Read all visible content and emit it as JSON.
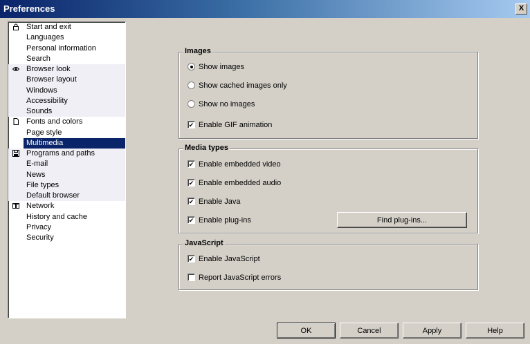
{
  "window": {
    "title": "Preferences",
    "close_glyph": "X"
  },
  "nav": {
    "groups": [
      {
        "icon": "lock-icon",
        "items": [
          "Start and exit",
          "Languages",
          "Personal information",
          "Search"
        ]
      },
      {
        "icon": "eye-icon",
        "items": [
          "Browser look",
          "Browser layout",
          "Windows",
          "Accessibility",
          "Sounds"
        ]
      },
      {
        "icon": "document-icon",
        "items": [
          "Fonts and colors",
          "Page style",
          "Multimedia"
        ]
      },
      {
        "icon": "floppy-icon",
        "items": [
          "Programs and paths",
          "E-mail",
          "News",
          "File types",
          "Default browser"
        ]
      },
      {
        "icon": "network-icon",
        "items": [
          "Network",
          "History and cache",
          "Privacy",
          "Security"
        ]
      }
    ],
    "selected": "Multimedia"
  },
  "images": {
    "title": "Images",
    "show_images": "Show images",
    "show_cached": "Show cached images only",
    "show_none": "Show no images",
    "selected_option": "show_images",
    "gif_animation": {
      "label": "Enable GIF animation",
      "checked": true
    }
  },
  "media": {
    "title": "Media types",
    "video": {
      "label": "Enable embedded video",
      "checked": true
    },
    "audio": {
      "label": "Enable embedded audio",
      "checked": true
    },
    "java": {
      "label": "Enable Java",
      "checked": true
    },
    "plugins": {
      "label": "Enable plug-ins",
      "checked": true
    },
    "find_plugins": "Find plug-ins..."
  },
  "javascript": {
    "title": "JavaScript",
    "enable": {
      "label": "Enable JavaScript",
      "checked": true
    },
    "report_errors": {
      "label": "Report JavaScript errors",
      "checked": false
    }
  },
  "buttons": {
    "ok": "OK",
    "cancel": "Cancel",
    "apply": "Apply",
    "help": "Help"
  },
  "checkmark": "✔"
}
